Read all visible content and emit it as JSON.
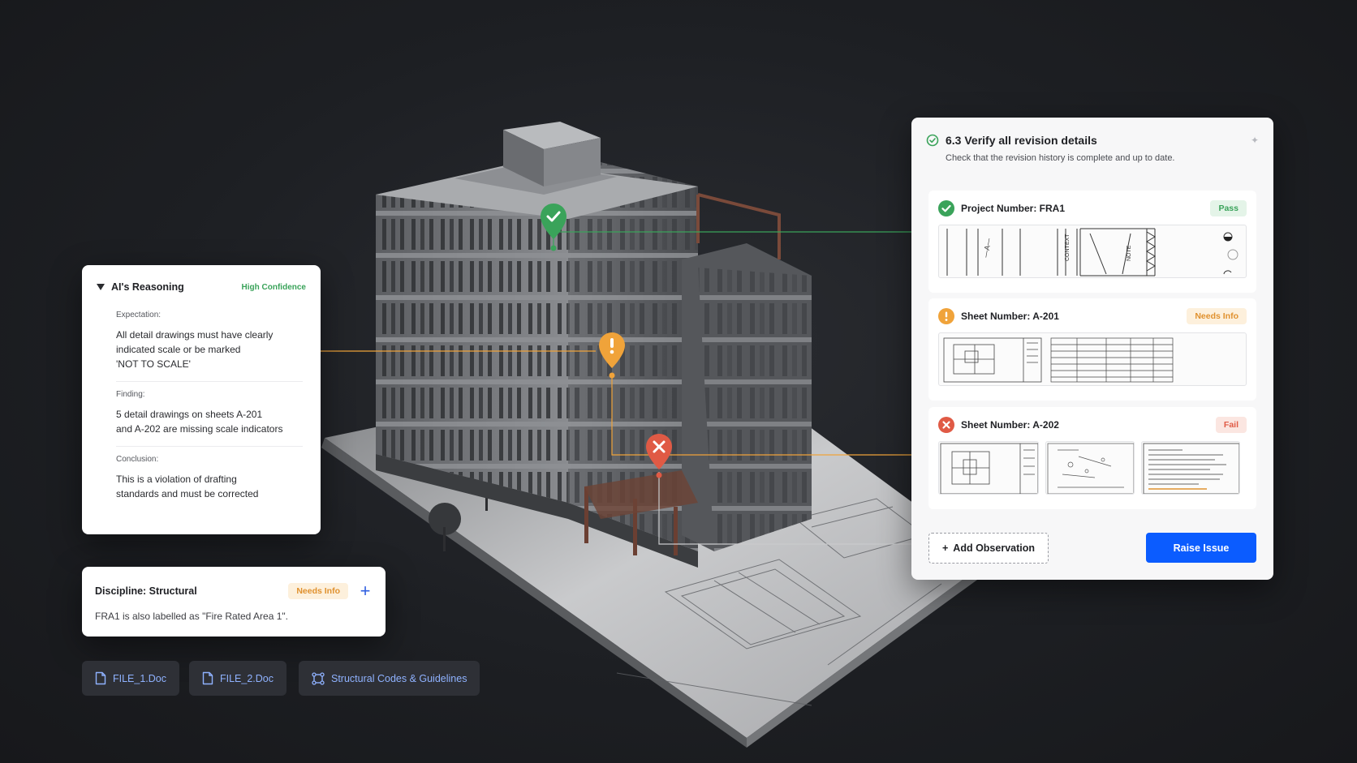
{
  "colors": {
    "pass": "#3aa35a",
    "warn": "#f0a33a",
    "fail": "#e05a45",
    "primary": "#0b5cff",
    "file_text": "#8fb2ff"
  },
  "markers": [
    {
      "status": "pass",
      "icon": "checkmark-icon"
    },
    {
      "status": "warn",
      "icon": "exclamation-icon"
    },
    {
      "status": "fail",
      "icon": "x-icon"
    }
  ],
  "reasoning": {
    "title": "AI's Reasoning",
    "confidence": "High Confidence",
    "sections": [
      {
        "label": "Expectation:",
        "text": "All detail drawings must have clearly\nindicated scale or be marked\n'NOT TO SCALE'"
      },
      {
        "label": "Finding:",
        "text": "5 detail drawings on sheets A-201\nand A-202 are missing scale indicators"
      },
      {
        "label": "Conclusion:",
        "text": "This is a violation of drafting\nstandards and must be corrected"
      }
    ]
  },
  "discipline": {
    "title": "Discipline: Structural",
    "badge": "Needs Info",
    "text": "FRA1 is also labelled as \"Fire Rated Area 1\"."
  },
  "files": [
    {
      "label": "FILE_1.Doc",
      "icon": "document-icon"
    },
    {
      "label": "FILE_2.Doc",
      "icon": "document-icon"
    },
    {
      "label": "Structural Codes & Guidelines",
      "icon": "framework-icon"
    }
  ],
  "panel": {
    "title": "6.3 Verify all revision details",
    "subtitle": "Check that the revision history is complete and up to date.",
    "items": [
      {
        "name": "Project Number: FRA1",
        "status": "Pass"
      },
      {
        "name": "Sheet Number: A-201",
        "status": "Needs Info"
      },
      {
        "name": "Sheet Number: A-202",
        "status": "Fail"
      }
    ],
    "add_label": "Add Observation",
    "raise_label": "Raise Issue"
  }
}
